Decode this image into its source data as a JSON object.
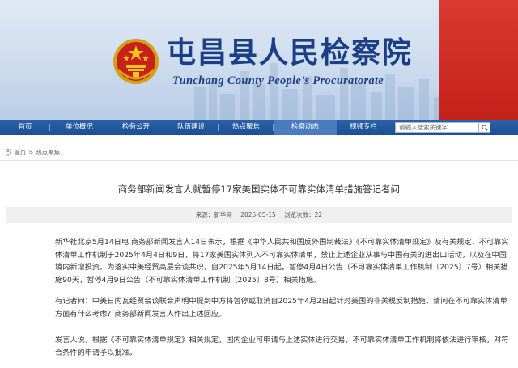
{
  "header": {
    "title": "屯昌县人民检察院",
    "subtitle": "Tunchang County People's Procuratorate"
  },
  "nav": {
    "items": [
      {
        "label": "首页"
      },
      {
        "label": "单位概况"
      },
      {
        "label": "检务公开"
      },
      {
        "label": "队伍建设"
      },
      {
        "label": "热点聚焦"
      },
      {
        "label": "检察动态"
      },
      {
        "label": "视频专栏"
      }
    ],
    "active_index": 5,
    "search_placeholder": "请输入搜索关键字"
  },
  "breadcrumb": {
    "home": "首页",
    "separator": ">",
    "current": "热点聚焦"
  },
  "article": {
    "title": "商务部新闻发言人就暂停17家美国实体不可靠实体清单措施答记者问",
    "source": "来源：新华网",
    "date": "2025-05-15",
    "views": "浏览次数：22",
    "paragraphs": [
      "新华社北京5月14日电 商务部新闻发言人14日表示，根据《中华人民共和国反外国制裁法》《不可靠实体清单规定》及有关规定，不可靠实体清单工作机制于2025年4月4日和9日，将17家美国实体列入不可靠实体清单，禁止上述企业从事与中国有关的进出口活动，以及在中国境内新增投资。为落实中美经贸高层会谈共识，自2025年5月14日起，暂停4月4日公告（不可靠实体清单工作机制〔2025〕7号）相关措施90天，暂停4月9日公告（不可靠实体清单工作机制〔2025〕8号）相关措施。",
      "有记者问：中美日内瓦经贸会谈联合声明中提到中方将暂停或取消自2025年4月2日起针对美国的非关税反制措施，请问在不可靠实体清单方面有什么考虑？商务部新闻发言人作出上述回应。",
      "发言人说，根据《不可靠实体清单规定》相关规定，国内企业可申请与上述实体进行交易，不可靠实体清单工作机制将依法进行审核，对符合条件的申请予以批准。"
    ]
  },
  "colors": {
    "brand_blue": "#1b3f86",
    "nav_blue": "#1c4f94",
    "banner_red": "#c4211b"
  }
}
